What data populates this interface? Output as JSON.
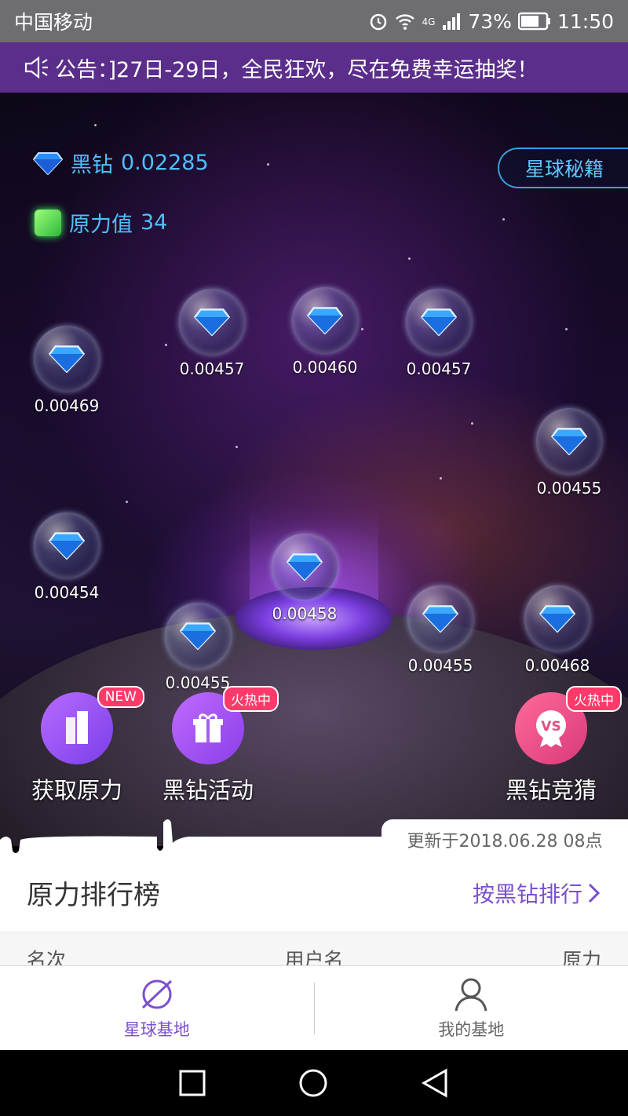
{
  "status_bar": {
    "carrier": "中国移动",
    "network": "4G",
    "battery": "73%",
    "time": "11:50"
  },
  "announcement": {
    "text": "公告：]27日-29日，全民狂欢，尽在免费幸运抽奖！"
  },
  "stats": {
    "black_diamond_label": "黑钻",
    "black_diamond_value": "0.02285",
    "force_label": "原力值",
    "force_value": "34"
  },
  "secret_button": "星球秘籍",
  "diamonds": [
    "0.00457",
    "0.00460",
    "0.00457",
    "0.00469",
    "0.00455",
    "0.00454",
    "0.00458",
    "0.00455",
    "0.00455",
    "0.00468"
  ],
  "actions": {
    "get_force": {
      "label": "获取原力",
      "badge": "NEW"
    },
    "diamond_event": {
      "label": "黑钻活动",
      "badge": "火热中"
    },
    "diamond_guess": {
      "label": "黑钻竞猜",
      "badge": "火热中",
      "icon_text": "VS"
    }
  },
  "updated_text": "更新于2018.06.28 08点",
  "ranking": {
    "title": "原力排行榜",
    "sort_label": "按黑钻排行",
    "columns": [
      "名次",
      "用户名",
      "原力"
    ]
  },
  "tabs": [
    {
      "label": "星球基地",
      "icon": "planet-icon",
      "active": true
    },
    {
      "label": "我的基地",
      "icon": "person-icon",
      "active": false
    }
  ],
  "colors": {
    "accent": "#7b4fd0",
    "announce_bg": "#5a2e8a",
    "stat_text": "#4ec0ff",
    "badge": "#ff3a6a"
  }
}
